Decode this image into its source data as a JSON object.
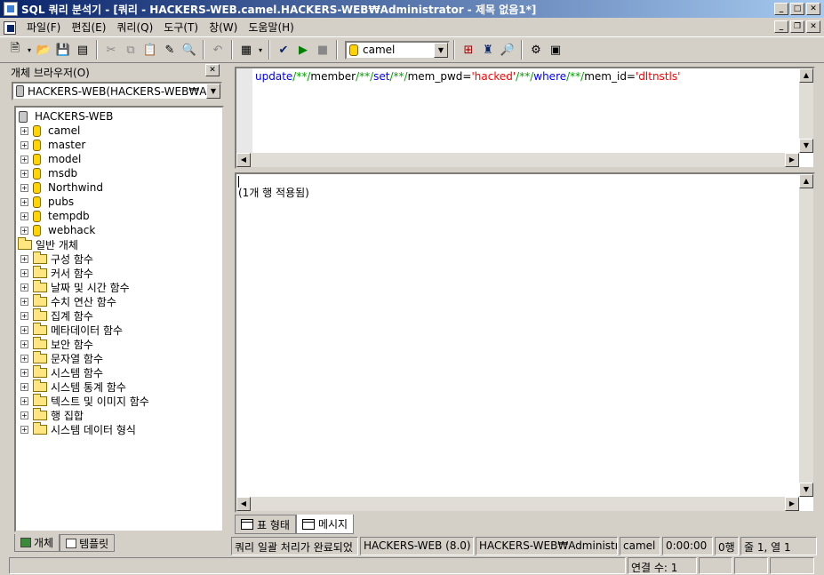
{
  "window": {
    "title": "SQL 쿼리 분석기 - [쿼리 - HACKERS-WEB.camel.HACKERS-WEB₩Administrator - 제목 없음1*]"
  },
  "menu": [
    "파일(F)",
    "편집(E)",
    "쿼리(Q)",
    "도구(T)",
    "창(W)",
    "도움말(H)"
  ],
  "toolbar": {
    "database": "camel"
  },
  "object_browser": {
    "title": "개체 브라우저(O)",
    "server": "HACKERS-WEB(HACKERS-WEB₩A",
    "root": "HACKERS-WEB",
    "databases": [
      "camel",
      "master",
      "model",
      "msdb",
      "Northwind",
      "pubs",
      "tempdb",
      "webhack"
    ],
    "common_objects": "일반 개체",
    "folders": [
      "구성 함수",
      "커서 함수",
      "날짜 및 시간 함수",
      "수치 연산 함수",
      "집계 함수",
      "메타데이터 함수",
      "보안 함수",
      "문자열 함수",
      "시스템 함수",
      "시스템 통계 함수",
      "텍스트 및 이미지 함수",
      "행 집합",
      "시스템 데이터 형식"
    ],
    "tabs": [
      "개체",
      "템플릿"
    ]
  },
  "editor": {
    "tokens": [
      {
        "t": "update",
        "c": "kw"
      },
      {
        "t": "/**/",
        "c": "cm"
      },
      {
        "t": "member",
        "c": ""
      },
      {
        "t": "/**/",
        "c": "cm"
      },
      {
        "t": "set",
        "c": "kw"
      },
      {
        "t": "/**/",
        "c": "cm"
      },
      {
        "t": "mem_pwd=",
        "c": ""
      },
      {
        "t": "'hacked'",
        "c": "str"
      },
      {
        "t": "/**/",
        "c": "cm"
      },
      {
        "t": "where",
        "c": "kw"
      },
      {
        "t": "/**/",
        "c": "cm"
      },
      {
        "t": "mem_id=",
        "c": ""
      },
      {
        "t": "'dltnstls'",
        "c": "str"
      }
    ]
  },
  "results": {
    "message": "(1개 행 적용됨)",
    "tabs": [
      "표 형태",
      "메시지"
    ]
  },
  "status_bar": {
    "query_status": "쿼리 일괄 처리가 완료되었",
    "server": "HACKERS-WEB (8.0)",
    "user": "HACKERS-WEB₩Administrat",
    "database": "camel",
    "elapsed": "0:00:00",
    "rows": "0행",
    "position": "줄 1, 열 1",
    "connections": "연결 수: 1"
  }
}
